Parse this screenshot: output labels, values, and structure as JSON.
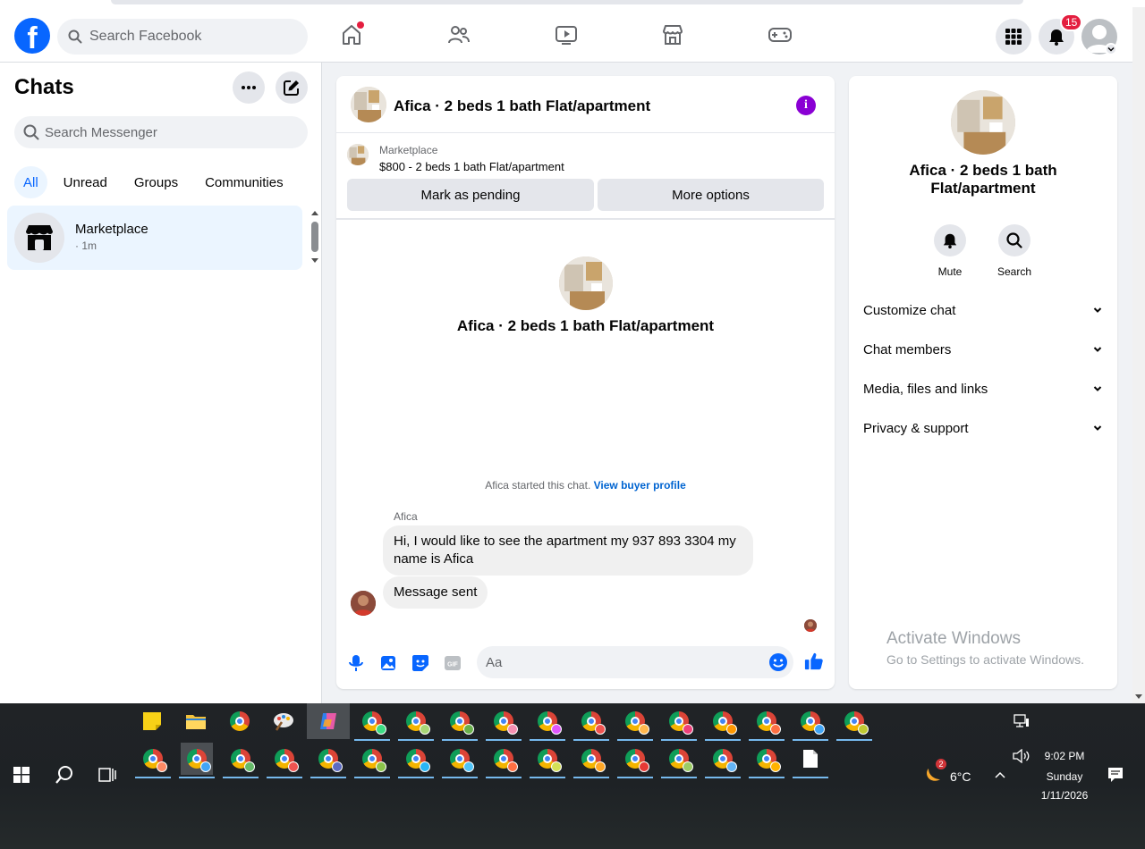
{
  "header": {
    "search_placeholder": "Search Facebook",
    "notifications_count": "15",
    "colors": {
      "brand": "#0866ff",
      "badge": "#e41e3f"
    }
  },
  "sidebar": {
    "title": "Chats",
    "search_placeholder": "Search Messenger",
    "filters": [
      "All",
      "Unread",
      "Groups",
      "Communities"
    ],
    "chat": {
      "name": "Marketplace",
      "time": "· 1m"
    }
  },
  "conversation": {
    "title": "Afica · 2 beds 1 bath Flat/apartment",
    "marketplace_label": "Marketplace",
    "listing": "$800 - 2 beds 1 bath Flat/apartment",
    "mark_pending": "Mark as pending",
    "more_options": "More options",
    "center_title": "Afica · 2 beds 1 bath Flat/apartment",
    "started_text": "Afica started this chat.",
    "view_profile": "View buyer profile",
    "sender_name": "Afica",
    "messages": [
      "Hi, I would like to see the apartment my 937 893 3304 my name is Afica",
      "Message sent"
    ],
    "composer_placeholder": "Aa"
  },
  "info_panel": {
    "title": "Afica · 2 beds 1 bath Flat/apartment",
    "actions": [
      "Mute",
      "Search"
    ],
    "sections": [
      "Customize chat",
      "Chat members",
      "Media, files and links",
      "Privacy & support"
    ]
  },
  "watermark": {
    "line1": "Activate Windows",
    "line2": "Go to Settings to activate Windows."
  },
  "taskbar": {
    "weather_badge": "2",
    "temperature": "6°C",
    "time": "9:02 PM",
    "day": "Sunday",
    "date": "1/11/2026"
  }
}
